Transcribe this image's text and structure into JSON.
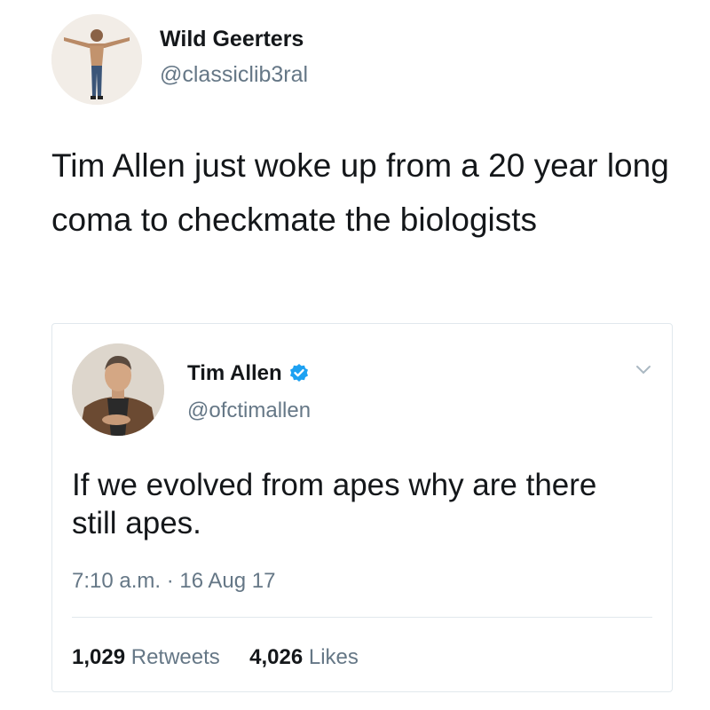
{
  "tweet": {
    "author": {
      "name": "Wild Geerters",
      "handle": "@classiclib3ral",
      "avatar": "shirtless-man-arms-outstretched"
    },
    "text": "Tim Allen just woke up from a 20 year long coma to checkmate the biologists",
    "quoted_tweet": {
      "author": {
        "name": "Tim Allen",
        "handle": "@ofctimallen",
        "verified": true,
        "avatar": "man-in-leather-jacket"
      },
      "text": "If we evolved from apes why are there still apes.",
      "timestamp": "7:10 a.m. · 16 Aug 17",
      "retweets": {
        "count": "1,029",
        "label": "Retweets"
      },
      "likes": {
        "count": "4,026",
        "label": "Likes"
      }
    }
  },
  "colors": {
    "text_primary": "#14171a",
    "text_secondary": "#657786",
    "verified_blue": "#1da1f2",
    "border": "#e1e8ed"
  }
}
